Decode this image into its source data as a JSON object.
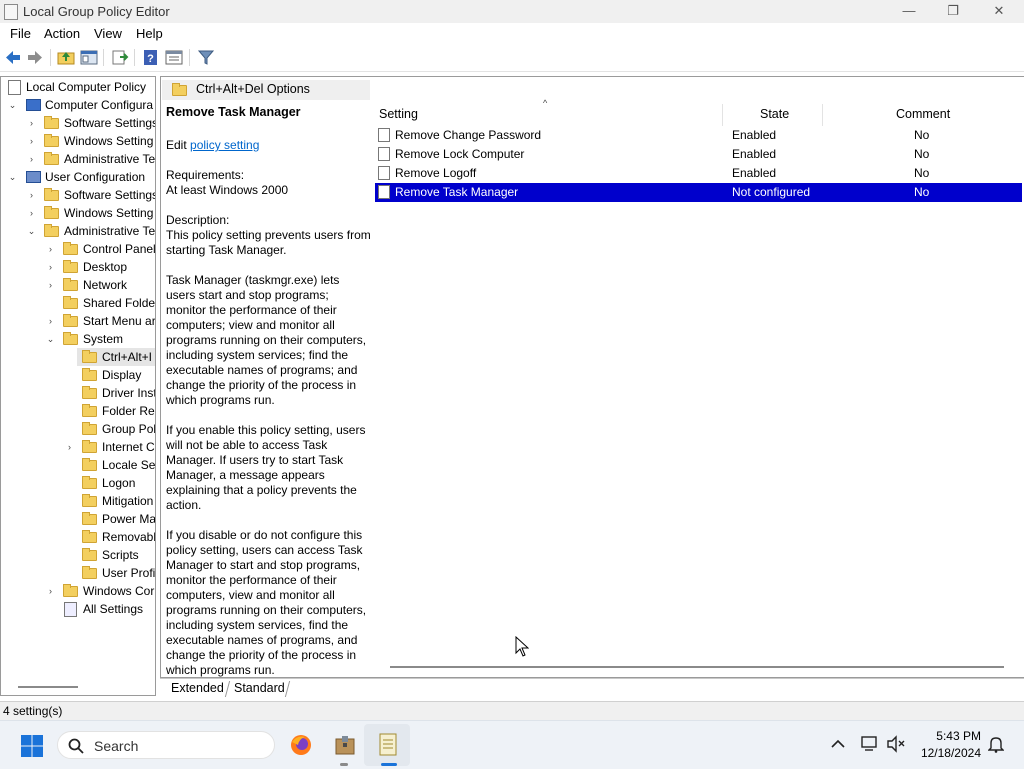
{
  "window": {
    "title": "Local Group Policy Editor",
    "controls": {
      "minimize": "—",
      "maximize": "❐",
      "close": "✕"
    }
  },
  "menu": [
    "File",
    "Action",
    "View",
    "Help"
  ],
  "tree": {
    "items": [
      {
        "label": "Local Computer Policy"
      },
      {
        "label": "Computer Configura"
      },
      {
        "label": "Software Settings"
      },
      {
        "label": "Windows Setting"
      },
      {
        "label": "Administrative Te"
      },
      {
        "label": "User Configuration"
      },
      {
        "label": "Software Settings"
      },
      {
        "label": "Windows Setting"
      },
      {
        "label": "Administrative Te"
      },
      {
        "label": "Control Panel"
      },
      {
        "label": "Desktop"
      },
      {
        "label": "Network"
      },
      {
        "label": "Shared Folder"
      },
      {
        "label": "Start Menu ar"
      },
      {
        "label": "System"
      },
      {
        "label": "Ctrl+Alt+I"
      },
      {
        "label": "Display"
      },
      {
        "label": "Driver Inst"
      },
      {
        "label": "Folder Red"
      },
      {
        "label": "Group Pol"
      },
      {
        "label": "Internet C"
      },
      {
        "label": "Locale Ser"
      },
      {
        "label": "Logon"
      },
      {
        "label": "Mitigation"
      },
      {
        "label": "Power Ma"
      },
      {
        "label": "Removabl"
      },
      {
        "label": "Scripts"
      },
      {
        "label": "User Profi"
      },
      {
        "label": "Windows Cor"
      },
      {
        "label": "All Settings"
      }
    ]
  },
  "breadcrumb": "Ctrl+Alt+Del Options",
  "description": {
    "heading": "Remove Task Manager",
    "edit_prefix": "Edit ",
    "edit_link": "policy setting",
    "requirements_label": "Requirements:",
    "requirements_value": "At least Windows 2000",
    "description_label": "Description:",
    "p1": "This policy setting prevents users from starting Task Manager.",
    "p2": "Task Manager (taskmgr.exe) lets users start and stop programs; monitor the performance of their computers; view and monitor all programs running on their computers, including system services; find the executable names of programs; and change the priority of the process in which programs run.",
    "p3": "If you enable this policy setting, users will not be able to access Task Manager. If users try to start Task Manager, a message appears explaining that a policy prevents the action.",
    "p4": "If you disable or do not configure this policy setting, users can access Task Manager to  start and stop programs, monitor the performance of their computers, view and monitor all programs running on their computers, including system services, find the executable names of programs, and change the priority of the process in which programs run."
  },
  "list": {
    "columns": [
      "Setting",
      "State",
      "Comment"
    ],
    "rows": [
      {
        "setting": "Remove Change Password",
        "state": "Enabled",
        "comment": "No"
      },
      {
        "setting": "Remove Lock Computer",
        "state": "Enabled",
        "comment": "No"
      },
      {
        "setting": "Remove Logoff",
        "state": "Enabled",
        "comment": "No"
      },
      {
        "setting": "Remove Task Manager",
        "state": "Not configured",
        "comment": "No"
      }
    ],
    "selected_index": 3
  },
  "tabs": [
    "Extended",
    "Standard"
  ],
  "status": "4 setting(s)",
  "taskbar": {
    "search_placeholder": "Search",
    "time": "5:43 PM",
    "date": "12/18/2024"
  },
  "colors": {
    "selection": "#0000cc",
    "folder": "#f3cf5f"
  }
}
